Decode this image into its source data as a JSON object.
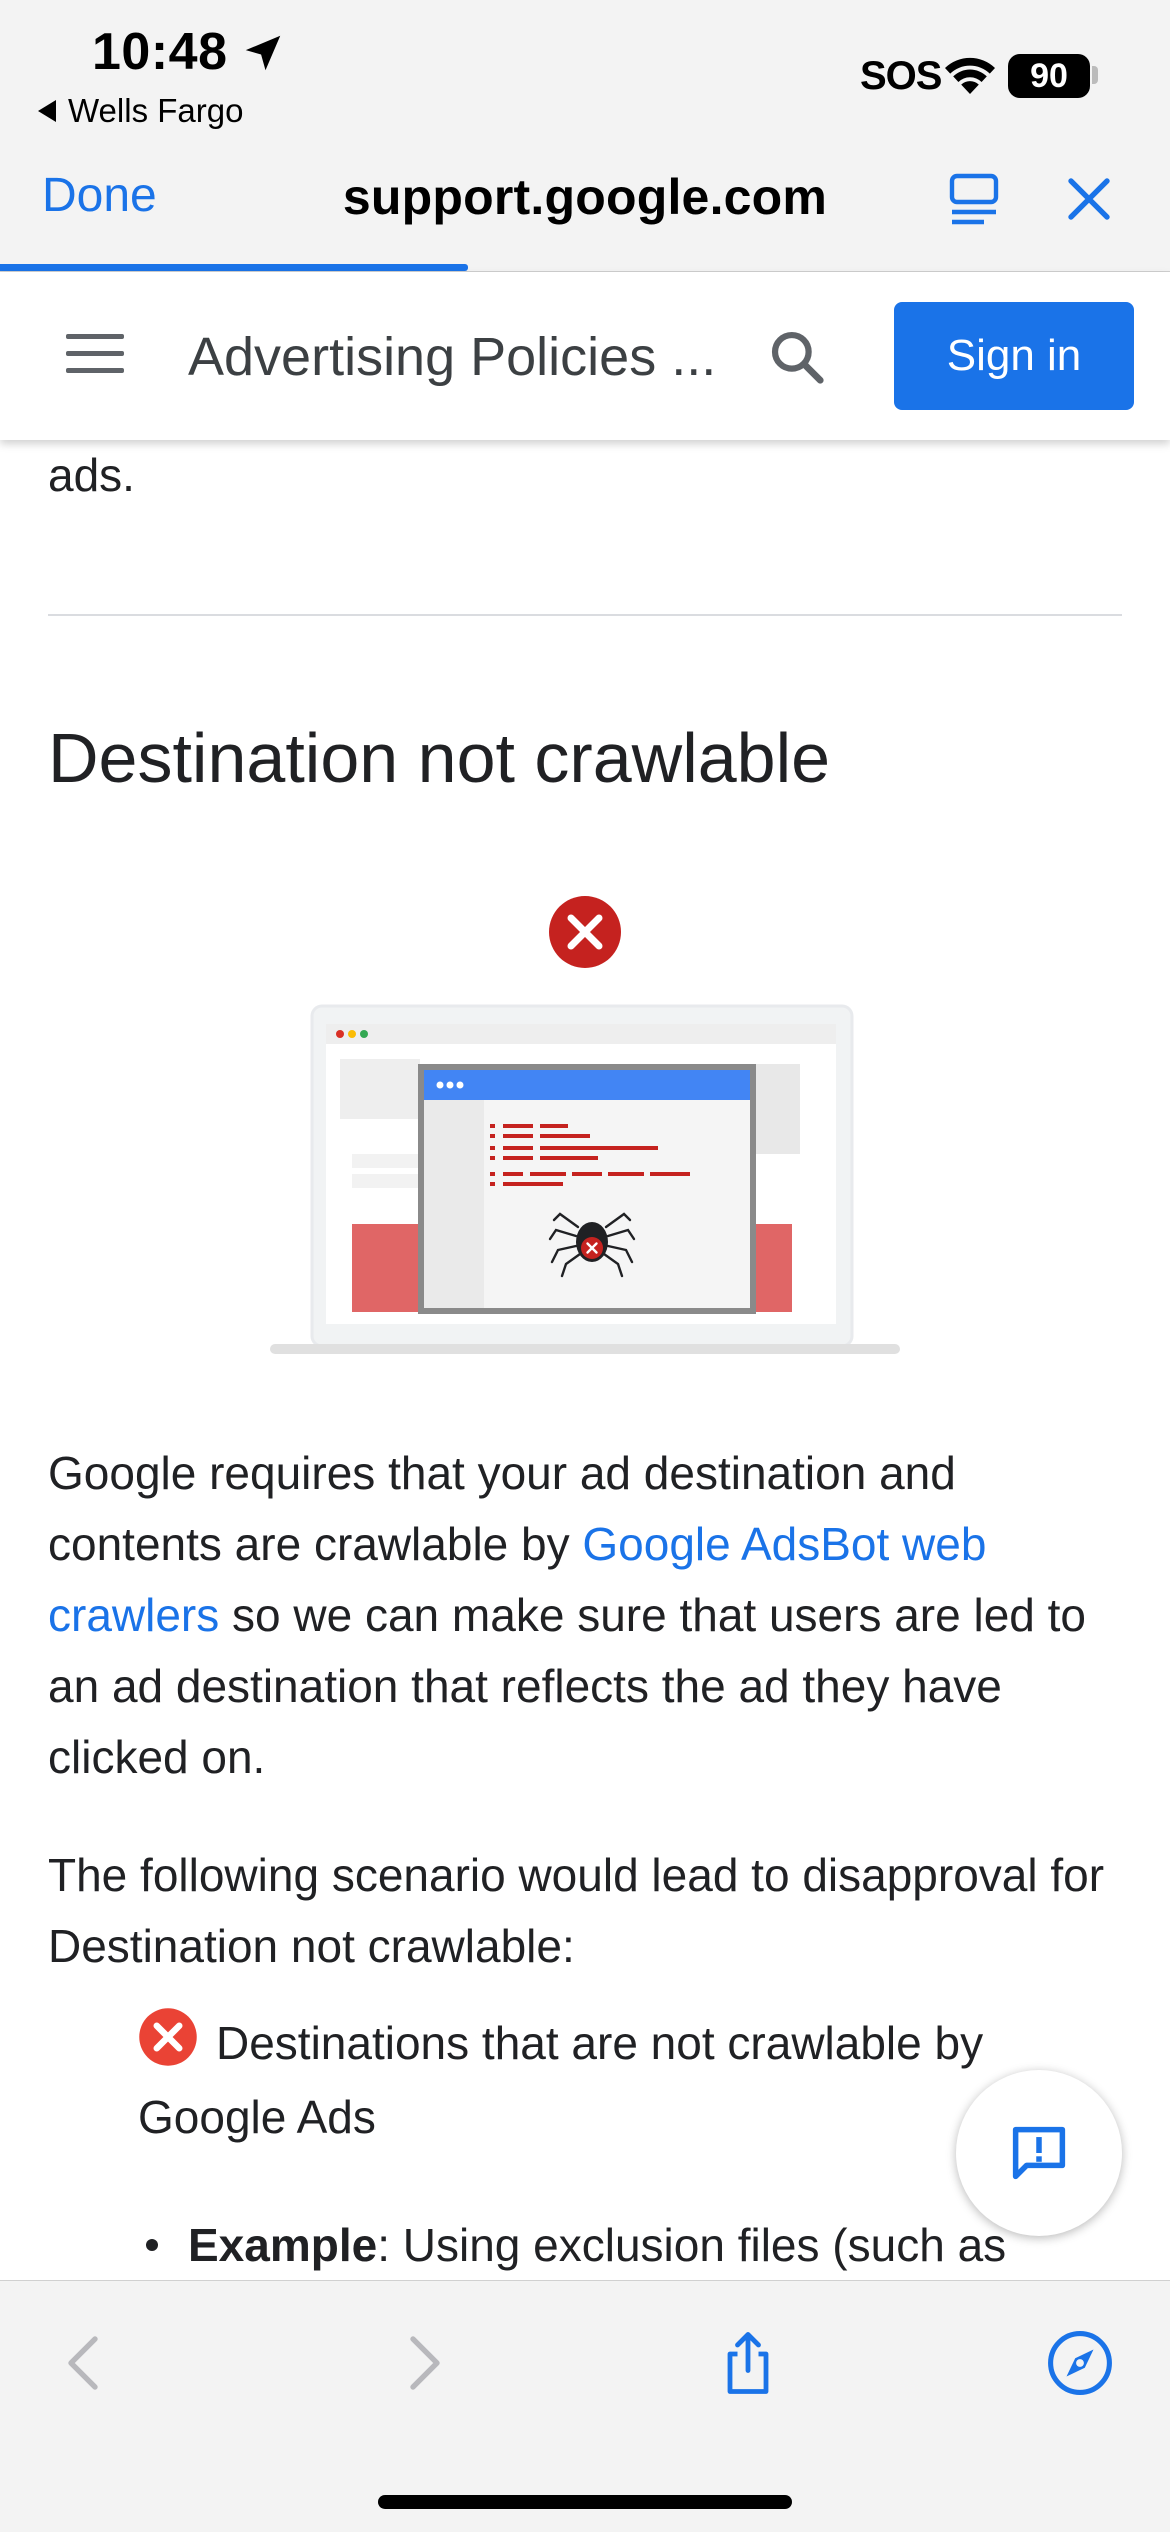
{
  "status_bar": {
    "time": "10:48",
    "back_app": "Wells Fargo",
    "carrier": "SOS",
    "battery": "90"
  },
  "browser": {
    "done_label": "Done",
    "url": "support.google.com"
  },
  "page_header": {
    "title": "Advertising Policies ...",
    "signin_label": "Sign in"
  },
  "article": {
    "prev_fragment": "ads.",
    "heading": "Destination not crawlable",
    "para1_before": "Google requires that your ad destination and contents are crawlable by ",
    "para1_link": "Google AdsBot web crawlers",
    "para1_after": " so we can make sure that users are led to an ad destination that reflects the ad they have clicked on.",
    "para2": "The following scenario would lead to disapproval for Destination not crawlable:",
    "list_item": "Destinations that are not crawlable by Google Ads",
    "example_label": "Example",
    "example_text": ": Using exclusion files (such as"
  },
  "colors": {
    "accent": "#1a73e8",
    "error_red": "#d93025",
    "text": "#202124"
  },
  "icons": [
    "location-arrow-icon",
    "wifi-icon",
    "reader-mode-icon",
    "close-icon",
    "menu-icon",
    "search-icon",
    "error-x-icon",
    "feedback-icon",
    "back-arrow-icon",
    "forward-arrow-icon",
    "share-icon",
    "compass-icon"
  ]
}
